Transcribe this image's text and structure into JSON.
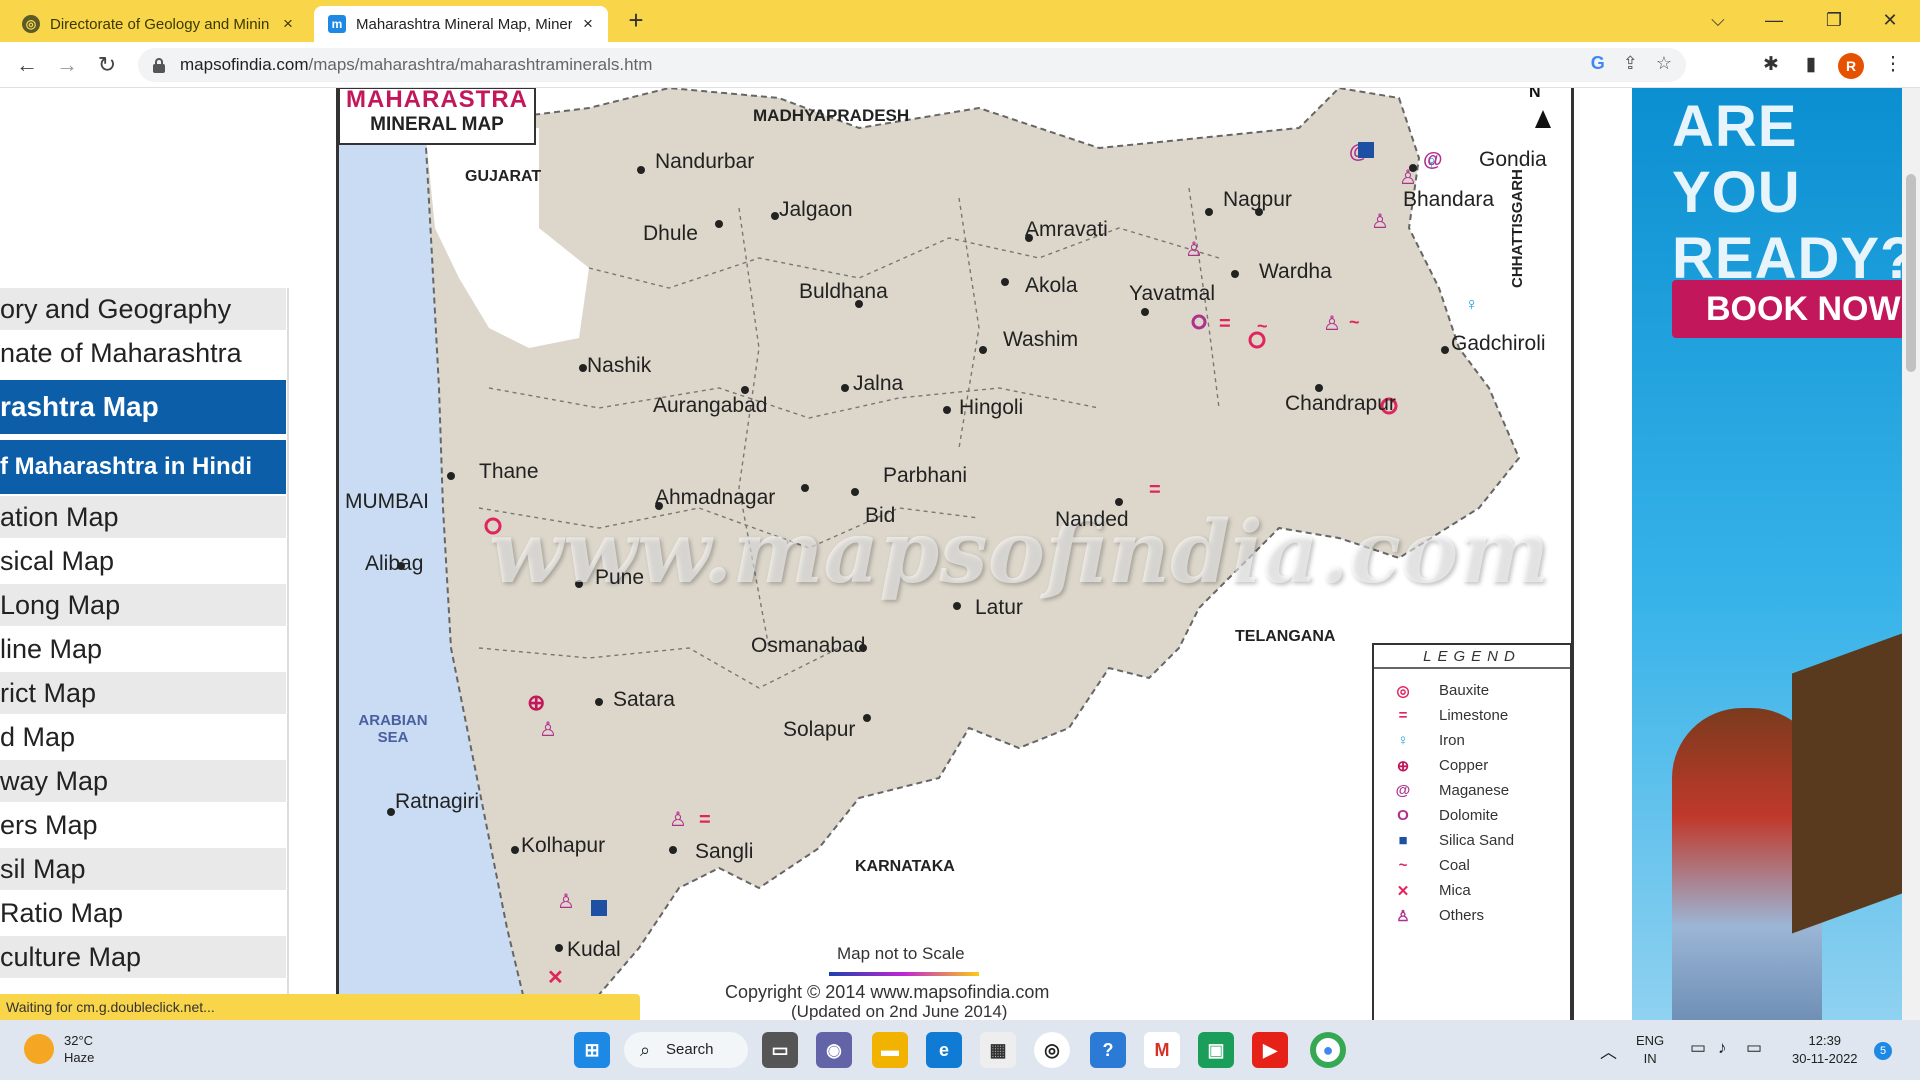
{
  "tabs": [
    {
      "title": "Directorate of Geology and Minin",
      "favicon": "globe-icon",
      "close": "×"
    },
    {
      "title": "Maharashtra Mineral Map, Miner",
      "favicon": "m",
      "close": "×"
    }
  ],
  "new_tab": "+",
  "window_controls": {
    "minimize": "—",
    "maximize": "❐",
    "close": "✕",
    "tab_search": "⌵"
  },
  "nav": {
    "back": "←",
    "forward": "→",
    "reload": "↻"
  },
  "address": {
    "host": "mapsofindia.com",
    "path": "/maps/maharashtra/maharashtraminerals.htm"
  },
  "omnibox_icons": {
    "google": "G",
    "share": "⇪",
    "bookmark": "☆"
  },
  "profile": {
    "initial": "R"
  },
  "sidebar": {
    "items": [
      {
        "label": "ory and Geography",
        "style": "gray"
      },
      {
        "label": "nate of Maharashtra",
        "style": "plain"
      },
      {
        "label": "rashtra Map",
        "style": "blue"
      },
      {
        "label": "f Maharashtra in Hindi",
        "style": "blue"
      },
      {
        "label": "ation Map",
        "style": "gray"
      },
      {
        "label": "sical Map",
        "style": "plain"
      },
      {
        "label": "Long Map",
        "style": "gray"
      },
      {
        "label": "line Map",
        "style": "plain"
      },
      {
        "label": "rict Map",
        "style": "gray"
      },
      {
        "label": "d Map",
        "style": "plain"
      },
      {
        "label": "way Map",
        "style": "gray"
      },
      {
        "label": "ers Map",
        "style": "plain"
      },
      {
        "label": "sil Map",
        "style": "gray"
      },
      {
        "label": " Ratio Map",
        "style": "plain"
      },
      {
        "label": "culture Map",
        "style": "gray"
      }
    ]
  },
  "map": {
    "title_line1": "MAHARASTRA",
    "title_line2": "MINERAL MAP",
    "north": "N",
    "states": {
      "madhya_pradesh": "MADHYAPRADESH",
      "gujarat": "GUJARAT",
      "chhattisgarh": "CHHATTISGARH",
      "telangana": "TELANGANA",
      "karnataka": "KARNATAKA"
    },
    "sea": "ARABIAN SEA",
    "cities": {
      "nandurbar": "Nandurbar",
      "jalgaon": "Jalgaon",
      "dhule": "Dhule",
      "amravati": "Amravati",
      "nagpur": "Nagpur",
      "bhandara": "Bhandara",
      "gondia": "Gondia",
      "wardha": "Wardha",
      "akola": "Akola",
      "yavatmal": "Yavatmal",
      "buldhana": "Buldhana",
      "washim": "Washim",
      "gadchiroli": "Gadchiroli",
      "chandrapur": "Chandrapur",
      "nashik": "Nashik",
      "jalna": "Jalna",
      "aurangabad": "Aurangabad",
      "hingoli": "Hingoli",
      "thane": "Thane",
      "mumbai": "MUMBAI",
      "parbhani": "Parbhani",
      "ahmadnagar": "Ahmadnagar",
      "bid": "Bid",
      "nanded": "Nanded",
      "alibag": "Alibag",
      "pune": "Pune",
      "latur": "Latur",
      "osmanabad": "Osmanabad",
      "satara": "Satara",
      "solapur": "Solapur",
      "ratnagiri": "Ratnagiri",
      "kolhapur": "Kolhapur",
      "sangli": "Sangli",
      "kudal": "Kudal"
    },
    "watermark": "www.mapsofindia.com",
    "scale_note": "Map not to Scale",
    "copyright": "Copyright © 2014 www.mapsofindia.com",
    "updated": "(Updated on 2nd June 2014)",
    "legend": {
      "title": "LEGEND",
      "items": [
        {
          "label": "Bauxite",
          "icon": "bauxite-icon",
          "color": "#e0245e"
        },
        {
          "label": "Limestone",
          "icon": "limestone-icon",
          "color": "#e0245e"
        },
        {
          "label": "Iron",
          "icon": "iron-icon",
          "color": "#1ea0d6"
        },
        {
          "label": "Copper",
          "icon": "copper-icon",
          "color": "#c2185b"
        },
        {
          "label": "Maganese",
          "icon": "manganese-icon",
          "color": "#b0308f"
        },
        {
          "label": "Dolomite",
          "icon": "dolomite-icon",
          "color": "#b0308f"
        },
        {
          "label": "Silica Sand",
          "icon": "silica-sand-icon",
          "color": "#1d4fa3"
        },
        {
          "label": "Coal",
          "icon": "coal-icon",
          "color": "#e0245e"
        },
        {
          "label": "Mica",
          "icon": "mica-icon",
          "color": "#e0245e"
        },
        {
          "label": "Others",
          "icon": "others-icon",
          "color": "#b0308f"
        }
      ]
    }
  },
  "ad": {
    "headline": "ARE YOU READY?",
    "button": "BOOK NOW"
  },
  "status_bar": "Waiting for cm.g.doubleclick.net...",
  "taskbar": {
    "temp": "32°C",
    "weather": "Haze",
    "search": "Search",
    "lang_line1": "ENG",
    "lang_line2": "IN",
    "time": "12:39",
    "date": "30-11-2022",
    "notifications": "5"
  }
}
